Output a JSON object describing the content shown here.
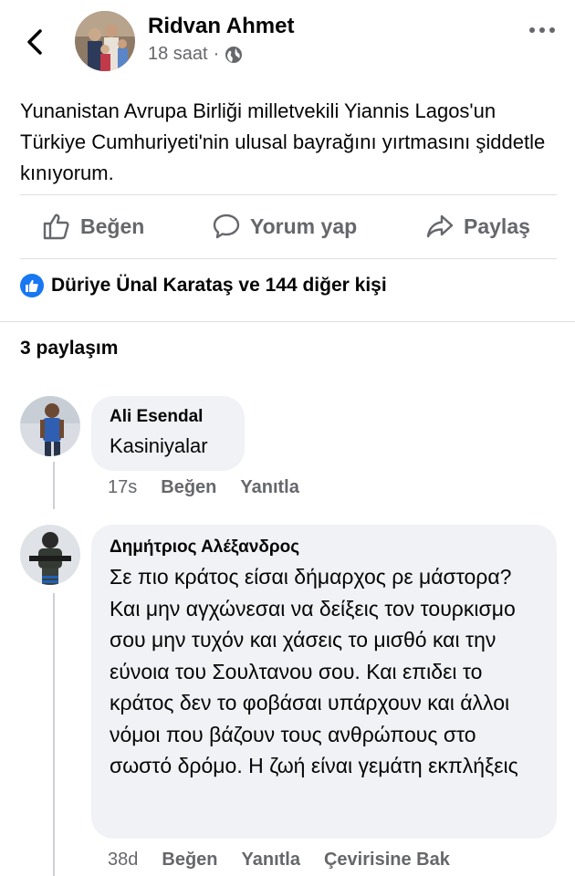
{
  "header": {
    "author": "Ridvan Ahmet",
    "time": "18 saat",
    "separator": "·",
    "icons": {
      "back": "chevron-left-icon",
      "privacy": "globe-icon",
      "more": "more-dots-icon"
    }
  },
  "post": {
    "text": "Yunanistan Avrupa Birliği milletvekili Yiannis Lagos'un Türkiye Cumhuriyeti'nin ulusal bayrağını yırtmasını şiddetle kınıyorum."
  },
  "actions": {
    "like": "Beğen",
    "comment": "Yorum yap",
    "share": "Paylaş",
    "icons": {
      "like": "thumbs-up-icon",
      "comment": "speech-bubble-icon",
      "share": "share-arrow-icon"
    }
  },
  "reactions": {
    "text": "Düriye Ünal Karataş ve 144 diğer kişi"
  },
  "shares": {
    "text": "3 paylaşım"
  },
  "comments": [
    {
      "name": "Ali Esendal",
      "text": "Kasiniyalar",
      "time": "17s",
      "like": "Beğen",
      "reply": "Yanıtla"
    },
    {
      "name": "Δημήτριος Αλέξανδρος",
      "text": "Σε πιο κράτος είσαι δήμαρχος ρε μάστορα? Και μην αγχώνεσαι να δείξεις τον τουρκισμο σου μην τυχόν και χάσεις το μισθό και την εύνοια του Σουλτανου σου. Και επιδει το κράτος δεν το φοβάσαι υπάρχουν και άλλοι νόμοι που βάζουν τους ανθρώπους στο σωστό δρόμο. Η ζωή είναι γεμάτη εκπλήξεις",
      "time": "38d",
      "like": "Beğen",
      "reply": "Yanıtla",
      "translate": "Çevirisine Bak"
    }
  ],
  "colors": {
    "accent": "#1877f2",
    "muted": "#65676b",
    "bubble": "#f0f2f5"
  }
}
